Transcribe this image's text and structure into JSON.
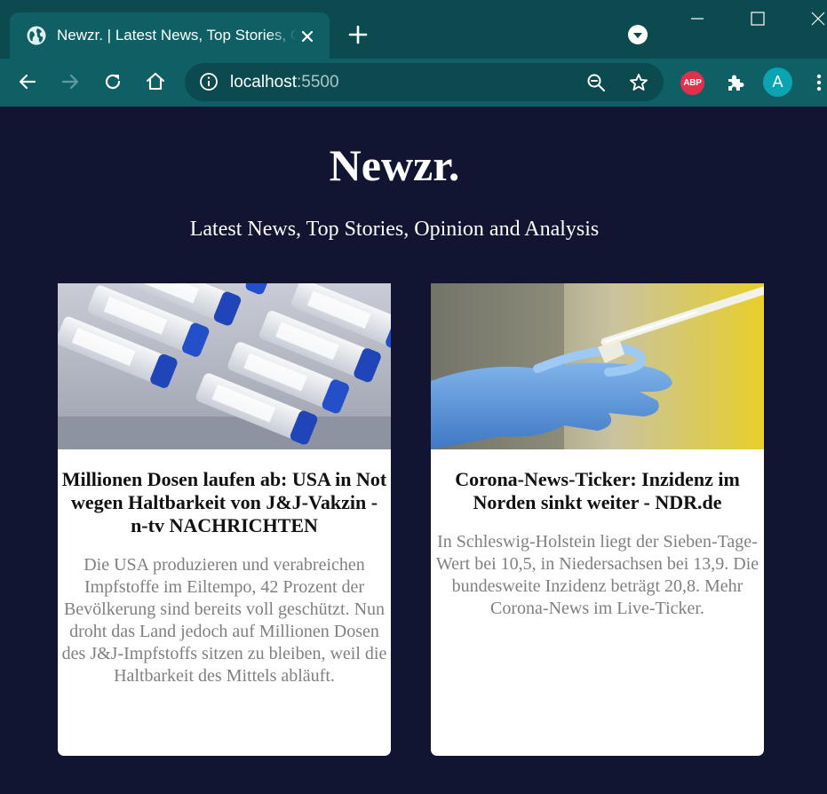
{
  "browser": {
    "tab": {
      "title": "Newzr. | Latest News, Top Stories, Opinion and Analysis",
      "favicon": "globe-icon"
    },
    "address": {
      "host": "localhost",
      "port": ":5500"
    },
    "extensions": {
      "adblock_label": "ABP"
    },
    "profile": {
      "initial": "A"
    },
    "colors": {
      "frame": "#0b4a4f",
      "toolbar": "#0f6065",
      "avatar": "#0aa4b3",
      "adblock": "#e2304a"
    }
  },
  "page": {
    "title": "Newzr.",
    "subtitle": "Latest News, Top Stories, Opinion and Analysis",
    "background": "#121532"
  },
  "articles": [
    {
      "image": "vaccine-vials-image",
      "headline": "Millionen Dosen laufen ab: USA in Not wegen Haltbarkeit von J&J-Vakzin - n-tv NACHRICHTEN",
      "description": "Die USA produzieren und verabreichen Impfstoffe im Eiltempo, 42 Prozent der Bevölkerung sind bereits voll geschützt. Nun droht das Land jedoch auf Millionen Dosen des J&J-Impfstoffs sitzen zu bleiben, weil die Haltbarkeit des Mittels abläuft."
    },
    {
      "image": "lab-glove-pipette-image",
      "headline": "Corona-News-Ticker: Inzidenz im Norden sinkt weiter - NDR.de",
      "description": "In Schleswig-Holstein liegt der Sieben-Tage-Wert bei 10,5, in Niedersachsen bei 13,9. Die bundesweite Inzidenz beträgt 20,8. Mehr Corona-News im Live-Ticker."
    }
  ]
}
